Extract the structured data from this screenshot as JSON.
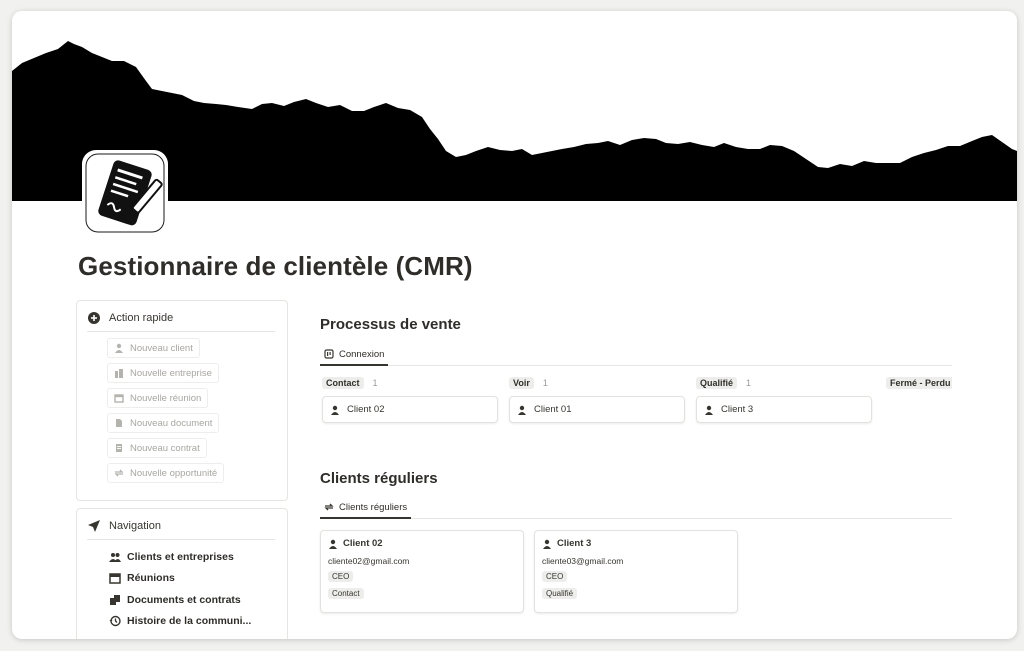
{
  "page": {
    "title": "Gestionnaire de clientèle (CMR)"
  },
  "quick_actions": {
    "heading": "Action rapide",
    "buttons": [
      {
        "label": "Nouveau client",
        "icon": "person-icon"
      },
      {
        "label": "Nouvelle entreprise",
        "icon": "building-icon"
      },
      {
        "label": "Nouvelle réunion",
        "icon": "calendar-icon"
      },
      {
        "label": "Nouveau document",
        "icon": "document-icon"
      },
      {
        "label": "Nouveau contrat",
        "icon": "contract-icon"
      },
      {
        "label": "Nouvelle opportunité",
        "icon": "repeat-icon"
      }
    ]
  },
  "navigation": {
    "heading": "Navigation",
    "items": [
      {
        "label": "Clients et entreprises",
        "icon": "people-icon"
      },
      {
        "label": "Réunions",
        "icon": "calendar-icon"
      },
      {
        "label": "Documents et contrats",
        "icon": "documents-icon"
      },
      {
        "label": "Histoire de la communi...",
        "icon": "history-icon"
      }
    ]
  },
  "sales": {
    "title": "Processus de vente",
    "tab": "Connexion",
    "columns": [
      {
        "tag": "Contact",
        "count": "1",
        "cards": [
          "Client 02"
        ]
      },
      {
        "tag": "Voir",
        "count": "1",
        "cards": [
          "Client 01"
        ]
      },
      {
        "tag": "Qualifié",
        "count": "1",
        "cards": [
          "Client 3"
        ]
      },
      {
        "tag": "Fermé - Perdu",
        "count": "",
        "cards": []
      }
    ]
  },
  "regulars": {
    "title": "Clients réguliers",
    "tab": "Clients réguliers",
    "cards": [
      {
        "name": "Client 02",
        "email": "cliente02@gmail.com",
        "role": "CEO",
        "status": "Contact"
      },
      {
        "name": "Client 3",
        "email": "cliente03@gmail.com",
        "role": "CEO",
        "status": "Qualifié"
      }
    ]
  },
  "colors": {
    "text": "#37352f",
    "tag_bg": "#ededeb",
    "border": "#e6e5e2",
    "cover": "#000000"
  }
}
